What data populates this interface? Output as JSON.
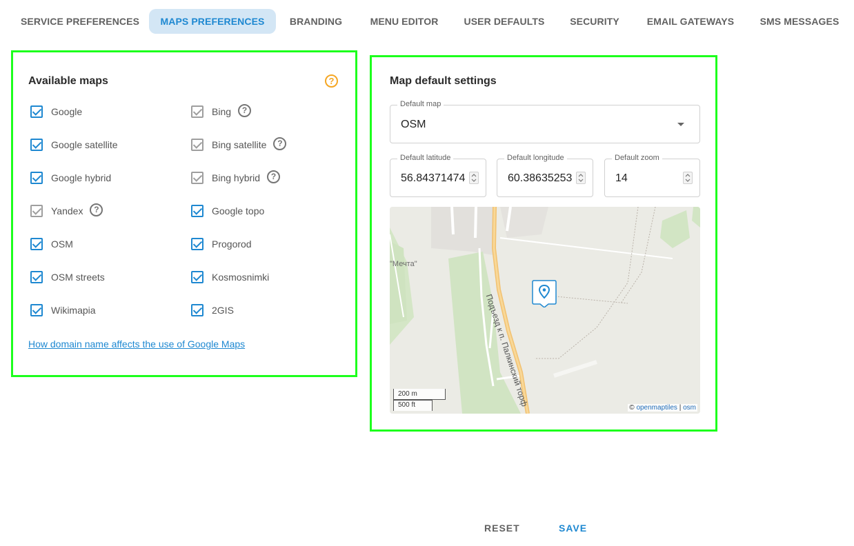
{
  "tabs": [
    {
      "label": "SERVICE PREFERENCES",
      "active": false
    },
    {
      "label": "MAPS PREFERENCES",
      "active": true
    },
    {
      "label": "BRANDING",
      "active": false
    },
    {
      "label": "MENU EDITOR",
      "active": false
    },
    {
      "label": "USER DEFAULTS",
      "active": false
    },
    {
      "label": "SECURITY",
      "active": false
    },
    {
      "label": "EMAIL GATEWAYS",
      "active": false
    },
    {
      "label": "SMS MESSAGES",
      "active": false
    }
  ],
  "available_maps": {
    "title": "Available maps",
    "help_icon": "help-circle-icon",
    "left_column": [
      {
        "label": "Google",
        "checked": true,
        "disabled": false,
        "help": false
      },
      {
        "label": "Google satellite",
        "checked": true,
        "disabled": false,
        "help": false
      },
      {
        "label": "Google hybrid",
        "checked": true,
        "disabled": false,
        "help": false
      },
      {
        "label": "Yandex",
        "checked": true,
        "disabled": true,
        "help": true
      },
      {
        "label": "OSM",
        "checked": true,
        "disabled": false,
        "help": false
      },
      {
        "label": "OSM streets",
        "checked": true,
        "disabled": false,
        "help": false
      },
      {
        "label": "Wikimapia",
        "checked": true,
        "disabled": false,
        "help": false
      }
    ],
    "right_column": [
      {
        "label": "Bing",
        "checked": true,
        "disabled": true,
        "help": true
      },
      {
        "label": "Bing satellite",
        "checked": true,
        "disabled": true,
        "help": true
      },
      {
        "label": "Bing hybrid",
        "checked": true,
        "disabled": true,
        "help": true
      },
      {
        "label": "Google topo",
        "checked": true,
        "disabled": false,
        "help": false
      },
      {
        "label": "Progorod",
        "checked": true,
        "disabled": false,
        "help": false
      },
      {
        "label": "Kosmosnimki",
        "checked": true,
        "disabled": false,
        "help": false
      },
      {
        "label": "2GIS",
        "checked": true,
        "disabled": false,
        "help": false
      }
    ],
    "link_text": "How domain name affects the use of Google Maps"
  },
  "map_defaults": {
    "title": "Map default settings",
    "default_map": {
      "label": "Default map",
      "value": "OSM"
    },
    "latitude": {
      "label": "Default latitude",
      "value": "56.84371474"
    },
    "longitude": {
      "label": "Default longitude",
      "value": "60.38635253"
    },
    "zoom": {
      "label": "Default zoom",
      "value": "14"
    },
    "map": {
      "place_label": "\"Мечта\"",
      "road_label": "Подъезд к п. Палкинский торф",
      "scale_metric": "200 m",
      "scale_imperial": "500 ft",
      "attribution_prefix": "©",
      "attribution_link1": "openmaptiles",
      "attribution_sep": "|",
      "attribution_link2": "osm"
    }
  },
  "actions": {
    "reset_label": "RESET",
    "save_label": "SAVE"
  },
  "colors": {
    "accent": "#1e88d1",
    "active_tab_bg": "#d3e6f5",
    "highlight_border": "#1cff1c",
    "help_orange": "#f5a623"
  }
}
